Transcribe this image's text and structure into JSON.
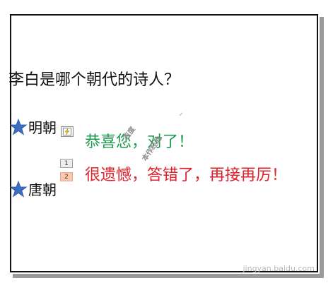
{
  "slide": {
    "question": "李白是哪个朝代的诗人？",
    "options": [
      {
        "label": "明朝"
      },
      {
        "label": "唐朝"
      }
    ],
    "trigger_badges": [
      "1",
      "2"
    ],
    "feedback_correct": "恭喜您，对了！",
    "feedback_wrong": "很遗憾，答错了，再接再厉！"
  },
  "watermarks": {
    "site_cn_a": "百度",
    "site_cn_b": "本作经验",
    "corner": "jingyan.baidu.com"
  },
  "colors": {
    "correct": "#1e9a4e",
    "wrong": "#e0202a",
    "star": "#3b6fc4"
  },
  "icons": {
    "star": "star-icon",
    "trigger": "lightning-trigger-icon"
  }
}
